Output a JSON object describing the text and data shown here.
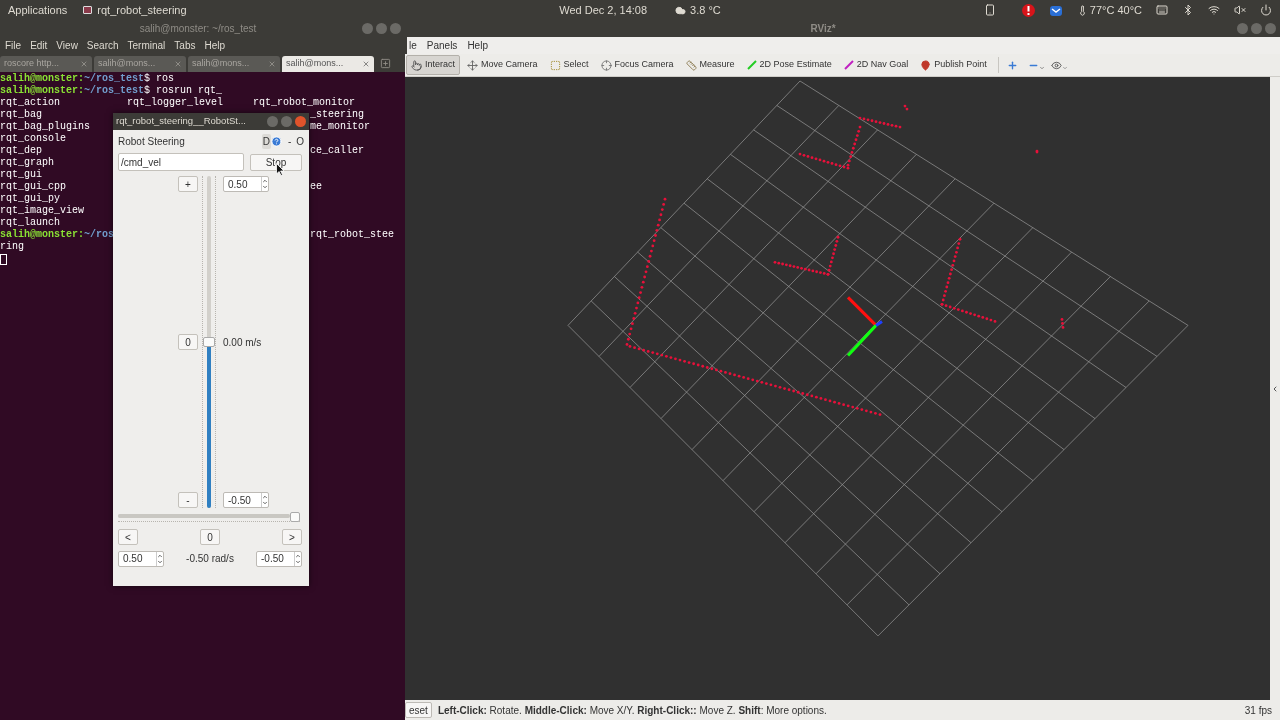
{
  "top_bar": {
    "applications": "Applications",
    "active_app": "rqt_robot_steering",
    "clock": "Wed Dec 2, 14:08",
    "weather": "3.8 °C",
    "temperatures": "77°C 40°C"
  },
  "terminal": {
    "title": "salih@monster: ~/ros_test",
    "menu": [
      "File",
      "Edit",
      "View",
      "Search",
      "Terminal",
      "Tabs",
      "Help"
    ],
    "tabs": [
      {
        "label": "roscore http...",
        "selected": false
      },
      {
        "label": "salih@mons...",
        "selected": false
      },
      {
        "label": "salih@mons...",
        "selected": false
      },
      {
        "label": "salih@mons...",
        "selected": true
      }
    ],
    "lines": [
      {
        "kind": "prompt",
        "user": "salih@monster:",
        "path": "~/ros_test",
        "command": "$ ros"
      },
      {
        "kind": "prompt",
        "user": "salih@monster:",
        "path": "~/ros_test",
        "command": "$ rosrun rqt_"
      },
      {
        "kind": "output",
        "columns": [
          "rqt_action",
          "rqt_logger_level",
          "rqt_robot_monitor"
        ]
      },
      {
        "kind": "output",
        "columns": [
          "rqt_bag"
        ],
        "clipped": "_steering"
      },
      {
        "kind": "output",
        "columns": [
          "rqt_bag_plugins"
        ],
        "clipped": "me_monitor"
      },
      {
        "kind": "output",
        "columns": [
          "rqt_console"
        ]
      },
      {
        "kind": "output",
        "columns": [
          "rqt_dep"
        ],
        "clipped": "ce_caller"
      },
      {
        "kind": "output",
        "columns": [
          "rqt_graph"
        ]
      },
      {
        "kind": "output",
        "columns": [
          "rqt_gui"
        ]
      },
      {
        "kind": "output",
        "columns": [
          "rqt_gui_cpp"
        ],
        "clipped": "ee"
      },
      {
        "kind": "output",
        "columns": [
          "rqt_gui_py"
        ]
      },
      {
        "kind": "output",
        "columns": [
          "rqt_image_view"
        ]
      },
      {
        "kind": "output",
        "columns": [
          "rqt_launch"
        ]
      },
      {
        "kind": "prompt",
        "user": "salih@monster:",
        "path": "~/ros",
        "clipped": "rqt_robot_stee"
      },
      {
        "kind": "output",
        "columns": [
          "ring"
        ]
      },
      {
        "kind": "cursor"
      }
    ]
  },
  "rqt_window": {
    "title": "rqt_robot_steering__RobotSt...",
    "plugin_title": "Robot Steering",
    "dock_button": "D",
    "minimize_button": "-",
    "close_button": "O",
    "topic": "/cmd_vel",
    "stop_button": "Stop",
    "linear": {
      "increase": "+",
      "reset": "0",
      "decrease": "-",
      "max": "0.50",
      "min": "-0.50",
      "reading": "0.00 m/s",
      "level": 0.5
    },
    "angular": {
      "left": "<",
      "reset": "0",
      "right": ">",
      "max": "0.50",
      "min": "-0.50",
      "reading": "-0.50 rad/s",
      "level": 1
    }
  },
  "rviz": {
    "title": "RViz*",
    "menu": [
      "le",
      "Panels",
      "Help"
    ],
    "tools": [
      {
        "label": "Interact",
        "kind": "interact",
        "selected": true
      },
      {
        "label": "Move Camera",
        "kind": "move_camera",
        "selected": false
      },
      {
        "label": "Select",
        "kind": "select",
        "selected": false
      },
      {
        "label": "Focus Camera",
        "kind": "focus_camera",
        "selected": false
      },
      {
        "label": "Measure",
        "kind": "measure",
        "selected": false
      },
      {
        "label": "2D Pose Estimate",
        "kind": "pose_estimate",
        "selected": false
      },
      {
        "label": "2D Nav Goal",
        "kind": "nav_goal",
        "selected": false
      },
      {
        "label": "Publish Point",
        "kind": "publish_point",
        "selected": false
      }
    ],
    "status": {
      "reset_button": "eset",
      "hint": "**Left-Click:** Rotate. **Middle-Click:** Move X/Y. **Right-Click::** Move Z. **Shift**: More options.",
      "fps": "31 fps"
    }
  }
}
